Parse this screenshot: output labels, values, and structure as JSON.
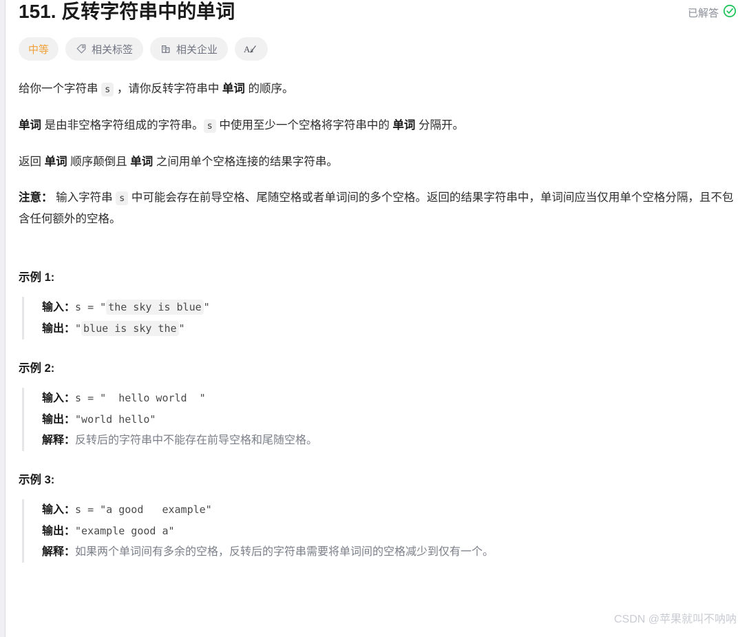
{
  "problem": {
    "title": "151. 反转字符串中的单词",
    "status_label": "已解答",
    "status_icon": "check-circle-icon",
    "status_color": "#22c55e"
  },
  "pills": {
    "difficulty": {
      "label": "中等",
      "color": "#f0a23a"
    },
    "tags": {
      "label": "相关标签",
      "icon": "tag-icon"
    },
    "companies": {
      "label": "相关企业",
      "icon": "building-icon"
    },
    "font": {
      "label": "Aa",
      "icon": "font-size-icon"
    }
  },
  "description": {
    "p1": {
      "a": "给你一个字符串 ",
      "code": "s",
      "b": " ，请你反转字符串中 ",
      "bold": "单词",
      "c": " 的顺序。"
    },
    "p2": {
      "bold1": "单词",
      "a": " 是由非空格字符组成的字符串。",
      "code": "s",
      "b": " 中使用至少一个空格将字符串中的 ",
      "bold2": "单词",
      "c": " 分隔开。"
    },
    "p3": {
      "a": "返回 ",
      "bold1": "单词",
      "b": " 顺序颠倒且 ",
      "bold2": "单词",
      "c": " 之间用单个空格连接的结果字符串。"
    },
    "note": {
      "label": "注意：",
      "a": " 输入字符串 ",
      "code": "s",
      "b": " 中可能会存在前导空格、尾随空格或者单词间的多个空格。返回的结果字符串中，单词间应当仅用单个空格分隔，且不包含任何额外的空格。"
    }
  },
  "examples": [
    {
      "title": "示例 1:",
      "input_label": "输入：",
      "input_prefix": "s = ",
      "input_quote_open": "\"",
      "input_value": "the sky is blue",
      "input_quote_close": "\"",
      "input_chip": true,
      "output_label": "输出：",
      "output_quote_open": "\"",
      "output_value": "blue is sky the",
      "output_quote_close": "\"",
      "output_chip": true,
      "explain_label": "",
      "explain_text": ""
    },
    {
      "title": "示例 2:",
      "input_label": "输入：",
      "input_prefix": "s = ",
      "input_quote_open": "",
      "input_value": "\"  hello world  \"",
      "input_quote_close": "",
      "input_chip": false,
      "output_label": "输出：",
      "output_quote_open": "",
      "output_value": "\"world hello\"",
      "output_quote_close": "",
      "output_chip": false,
      "explain_label": "解释：",
      "explain_text": "反转后的字符串中不能存在前导空格和尾随空格。"
    },
    {
      "title": "示例 3:",
      "input_label": "输入：",
      "input_prefix": "s = ",
      "input_quote_open": "",
      "input_value": "\"a good   example\"",
      "input_quote_close": "",
      "input_chip": false,
      "output_label": "输出：",
      "output_quote_open": "",
      "output_value": "\"example good a\"",
      "output_quote_close": "",
      "output_chip": false,
      "explain_label": "解释：",
      "explain_text": "如果两个单词间有多余的空格，反转后的字符串需要将单词间的空格减少到仅有一个。"
    }
  ],
  "watermark": "CSDN @苹果就叫不呐呐"
}
